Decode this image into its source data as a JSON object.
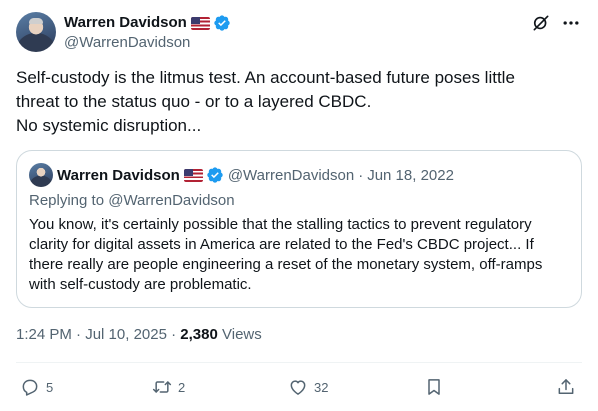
{
  "author": {
    "display_name": "Warren Davidson",
    "handle": "@WarrenDavidson",
    "flag": "🇺🇸",
    "verified_color": "#1d9bf0"
  },
  "tweet": {
    "lines": [
      "Self-custody is the litmus test. An account-based future poses little",
      "threat to the status quo - or to a layered CBDC.",
      "No systemic disruption..."
    ]
  },
  "quote": {
    "display_name": "Warren Davidson",
    "handle": "@WarrenDavidson",
    "separator": "·",
    "date": "Jun 18, 2022",
    "replying_prefix": "Replying to",
    "replying_handle": "@WarrenDavidson",
    "lines": [
      "You know, it's certainly possible that the stalling tactics to prevent regulatory",
      "clarity for digital assets in America are related to the Fed's CBDC project... If",
      "there really are people engineering a reset of the monetary system, off-ramps",
      "with self-custody are problematic."
    ]
  },
  "meta": {
    "time": "1:24 PM",
    "date": "Jul 10, 2025",
    "separator": "·",
    "views_count": "2,380",
    "views_label": "Views"
  },
  "actions": {
    "replies": "5",
    "reposts": "2",
    "likes": "32"
  },
  "icons": [
    "grok-icon",
    "more-icon",
    "reply-icon",
    "repost-icon",
    "like-icon",
    "bookmark-icon",
    "share-icon",
    "verified-badge-icon"
  ]
}
